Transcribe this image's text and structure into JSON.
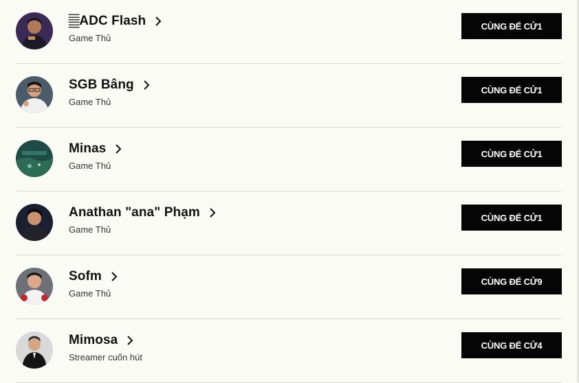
{
  "players": [
    {
      "name": "𝄛ADC Flash",
      "role": "Game Thủ",
      "cta": "CÙNG ĐỂ CỬ1",
      "avatar_icon": "avatar-adc-flash"
    },
    {
      "name": "SGB Bâng",
      "role": "Game Thủ",
      "cta": "CÙNG ĐỂ CỬ1",
      "avatar_icon": "avatar-sgb-bang"
    },
    {
      "name": "Minas",
      "role": "Game Thủ",
      "cta": "CÙNG ĐỂ CỬ1",
      "avatar_icon": "avatar-minas"
    },
    {
      "name": "Anathan \"ana\" Phạm",
      "role": "Game Thủ",
      "cta": "CÙNG ĐỂ CỬ1",
      "avatar_icon": "avatar-anathan"
    },
    {
      "name": "Sofm",
      "role": "Game Thủ",
      "cta": "CÙNG ĐỂ CỬ9",
      "avatar_icon": "avatar-sofm"
    },
    {
      "name": "Mimosa",
      "role": "Streamer cuốn hút",
      "cta": "CÙNG ĐỂ CỬ4",
      "avatar_icon": "avatar-mimosa"
    }
  ],
  "colors": {
    "background": "#fbfbf5",
    "button": "#050505",
    "button_text": "#ffffff",
    "divider": "#dcdcd6"
  }
}
